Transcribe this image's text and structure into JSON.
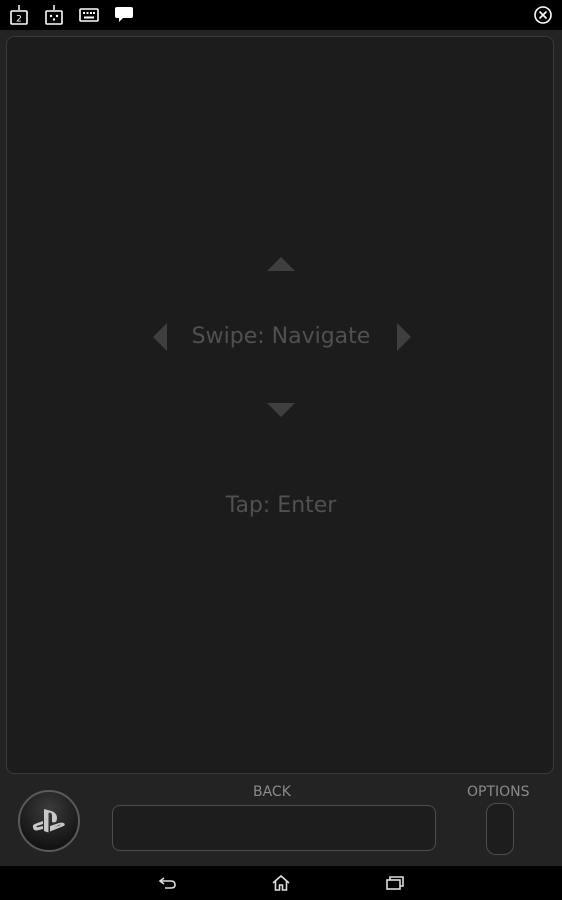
{
  "topbar": {
    "icons": [
      "second-screen-icon",
      "controller-icon",
      "keyboard-icon",
      "chat-icon",
      "close-icon"
    ]
  },
  "touchpad": {
    "swipe_hint": "Swipe: Navigate",
    "tap_hint": "Tap: Enter"
  },
  "controls": {
    "back_label": "BACK",
    "options_label": "OPTIONS"
  },
  "navbar": {
    "icons": [
      "back-icon",
      "home-icon",
      "recent-apps-icon"
    ]
  },
  "colors": {
    "background": "#000000",
    "panel": "#232323",
    "touchpad": "#1c1c1c",
    "hint_text": "#505050",
    "label_text": "#8a8a8a"
  }
}
